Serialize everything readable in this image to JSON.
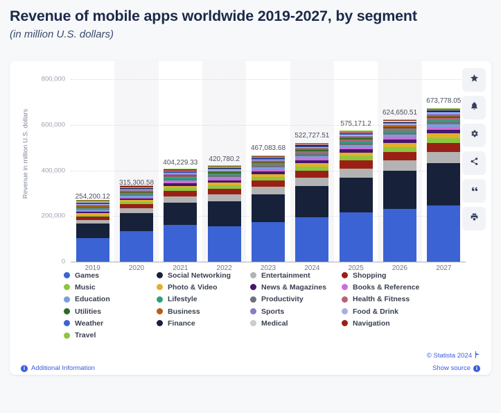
{
  "header": {
    "title": "Revenue of mobile apps worldwide 2019-2027, by segment",
    "subtitle": "(in million U.S. dollars)"
  },
  "toolbar": {
    "buttons": [
      {
        "name": "favorite",
        "label": "Favorite",
        "icon": "star-icon"
      },
      {
        "name": "alert",
        "label": "Create alert",
        "icon": "bell-icon"
      },
      {
        "name": "settings",
        "label": "Settings",
        "icon": "gear-icon"
      },
      {
        "name": "share",
        "label": "Share",
        "icon": "share-icon"
      },
      {
        "name": "cite",
        "label": "Cite",
        "icon": "quote-icon"
      },
      {
        "name": "print",
        "label": "Print",
        "icon": "print-icon"
      }
    ]
  },
  "footer": {
    "additional_information": "Additional Information",
    "copyright": "© Statista 2024",
    "show_source": "Show source"
  },
  "chart_data": {
    "type": "bar",
    "stacked": true,
    "title": "Revenue of mobile apps worldwide 2019-2027, by segment",
    "subtitle": "(in million U.S. dollars)",
    "xlabel": "",
    "ylabel": "Revenue in million U.S. dollars",
    "ylim": [
      0,
      800000
    ],
    "yticks": [
      0,
      200000,
      400000,
      600000,
      800000
    ],
    "ytick_labels": [
      "0",
      "200,000",
      "400,000",
      "600,000",
      "800,000"
    ],
    "grid": true,
    "legend_position": "bottom",
    "categories": [
      "2019",
      "2020",
      "2021",
      "2022",
      "2023",
      "2024",
      "2025",
      "2026",
      "2027"
    ],
    "totals": [
      254200.12,
      315300.58,
      404229.33,
      420780.2,
      467083.68,
      522727.51,
      575171.2,
      624650.51,
      673778.05
    ],
    "total_labels": [
      "254,200.12",
      "315,300.58",
      "404,229.33",
      "420,780.2",
      "467,083.68",
      "522,727.51",
      "575,171.2",
      "624,650.51",
      "673,778.05"
    ],
    "series": [
      {
        "name": "Games",
        "color": "#3b63d4",
        "values": [
          104000,
          135000,
          160000,
          155000,
          173000,
          196000,
          217000,
          230000,
          247000
        ]
      },
      {
        "name": "Social Networking",
        "color": "#17213a",
        "values": [
          62000,
          78000,
          98000,
          110000,
          122000,
          136000,
          152000,
          170000,
          186000
        ]
      },
      {
        "name": "Entertainment",
        "color": "#b3b3b3",
        "values": [
          17000,
          21000,
          28000,
          30000,
          33000,
          37000,
          40000,
          44000,
          47000
        ]
      },
      {
        "name": "Shopping",
        "color": "#9a2015",
        "values": [
          14000,
          18000,
          23000,
          25000,
          28000,
          31000,
          34000,
          38000,
          41000
        ]
      },
      {
        "name": "Music",
        "color": "#8dc63f",
        "values": [
          8000,
          10000,
          13000,
          14000,
          15500,
          17000,
          19000,
          20500,
          22000
        ]
      },
      {
        "name": "Photo & Video",
        "color": "#e0b02a",
        "values": [
          7000,
          8500,
          11000,
          11500,
          13000,
          14500,
          16000,
          17500,
          19000
        ]
      },
      {
        "name": "News & Magazines",
        "color": "#46176b",
        "values": [
          6000,
          7500,
          9500,
          10000,
          11000,
          12500,
          13500,
          15000,
          16000
        ]
      },
      {
        "name": "Books & Reference",
        "color": "#cb6fd6",
        "values": [
          5000,
          6200,
          8000,
          8500,
          9500,
          10500,
          11500,
          12500,
          13500
        ]
      },
      {
        "name": "Education",
        "color": "#7b9fd9",
        "values": [
          4200,
          5200,
          6800,
          7000,
          7800,
          8700,
          9500,
          10400,
          11200
        ]
      },
      {
        "name": "Productivity",
        "color": "#6e7278",
        "values": [
          3800,
          4700,
          6100,
          6400,
          7100,
          7900,
          8600,
          9400,
          10100
        ]
      },
      {
        "name": "Lifestyle",
        "color": "#2f9e7e",
        "values": [
          3400,
          4200,
          5500,
          5700,
          6300,
          7000,
          7700,
          8400,
          9000
        ]
      },
      {
        "name": "Health & Fitness",
        "color": "#bb6077",
        "values": [
          3000,
          3700,
          4800,
          5000,
          5600,
          6200,
          6800,
          7400,
          8000
        ]
      },
      {
        "name": "Utilities",
        "color": "#2c6b27",
        "values": [
          2700,
          3300,
          4300,
          4500,
          5000,
          5500,
          6100,
          6600,
          7100
        ]
      },
      {
        "name": "Business",
        "color": "#b85c18",
        "values": [
          2400,
          3000,
          3900,
          4000,
          4500,
          5000,
          5500,
          5900,
          6400
        ]
      },
      {
        "name": "Sports",
        "color": "#8d7ac4",
        "values": [
          2100,
          2600,
          3400,
          3500,
          3900,
          4300,
          4700,
          5100,
          5500
        ]
      },
      {
        "name": "Food & Drink",
        "color": "#a9b0de",
        "values": [
          1900,
          2300,
          3000,
          3100,
          3500,
          3900,
          4200,
          4600,
          4900
        ]
      },
      {
        "name": "Weather",
        "color": "#3b63d4",
        "values": [
          1700,
          2100,
          2700,
          2800,
          3100,
          3400,
          3700,
          4100,
          4400
        ]
      },
      {
        "name": "Finance",
        "color": "#17213a",
        "values": [
          1500,
          1800,
          2400,
          2500,
          2800,
          3100,
          3400,
          3700,
          4000
        ]
      },
      {
        "name": "Medical",
        "color": "#c9ccd1",
        "values": [
          1300,
          1600,
          2100,
          2200,
          2400,
          2700,
          2900,
          3200,
          3400
        ]
      },
      {
        "name": "Navigation",
        "color": "#9a2015",
        "values": [
          1100,
          1400,
          1800,
          1900,
          2100,
          2300,
          2500,
          2700,
          2900
        ]
      },
      {
        "name": "Travel",
        "color": "#8dc63f",
        "values": [
          900,
          1200,
          1500,
          1600,
          1800,
          2000,
          2200,
          2400,
          2600
        ]
      }
    ],
    "legend_columns": [
      [
        "Games",
        "Music",
        "Education",
        "Utilities",
        "Weather",
        "Travel"
      ],
      [
        "Social Networking",
        "Photo & Video",
        "Lifestyle",
        "Business",
        "Finance"
      ],
      [
        "Entertainment",
        "News & Magazines",
        "Productivity",
        "Sports",
        "Medical"
      ],
      [
        "Shopping",
        "Books & Reference",
        "Health & Fitness",
        "Food & Drink",
        "Navigation"
      ]
    ]
  }
}
